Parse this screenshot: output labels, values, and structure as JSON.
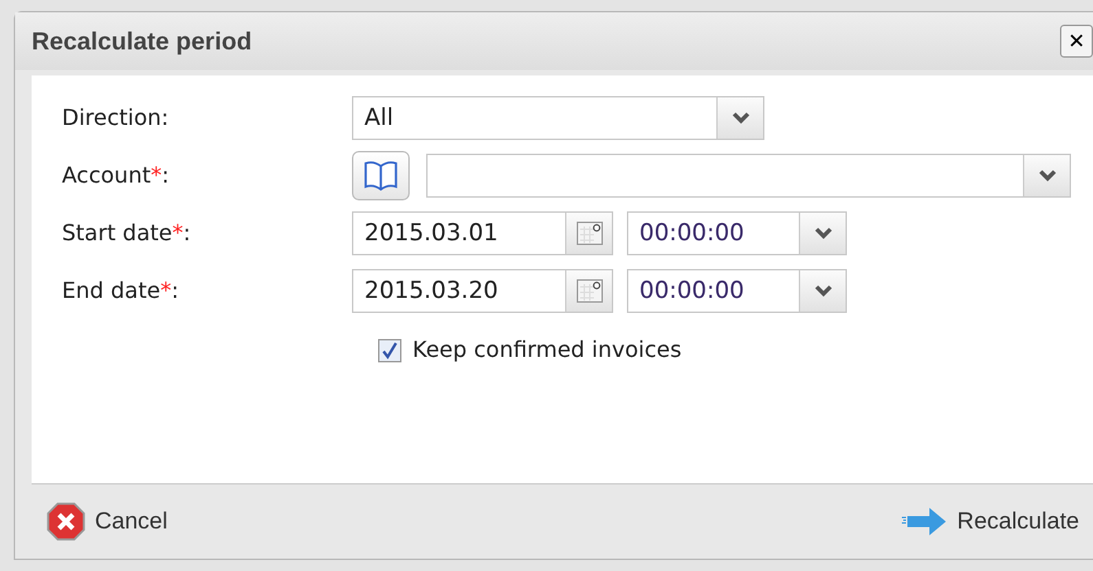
{
  "dialog": {
    "title": "Recalculate period",
    "close_label": "✕"
  },
  "fields": [
    {
      "kind": "select",
      "label": "Direction",
      "colon": ":",
      "value": "All"
    },
    {
      "kind": "lookup",
      "label": "Account",
      "required_mark": "*",
      "colon": ":"
    },
    {
      "kind": "datetime",
      "label": "Start date",
      "required_mark": "*",
      "colon": ":",
      "date": "2015.03.01",
      "time": "00:00:00"
    },
    {
      "kind": "datetime",
      "label": "End date",
      "required_mark": "*",
      "colon": ":",
      "date": "2015.03.20",
      "time": "00:00:00"
    }
  ],
  "checkbox": {
    "label": "Keep confirmed invoices",
    "checked": true
  },
  "buttons": [
    {
      "kind": "cancel",
      "label": "Cancel"
    },
    {
      "kind": "confirm",
      "label": "Recalculate"
    }
  ]
}
